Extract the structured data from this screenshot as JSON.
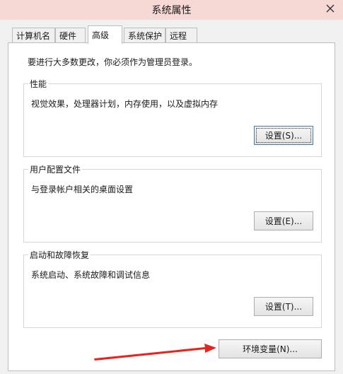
{
  "window": {
    "title": "系统属性"
  },
  "tabs": [
    {
      "label": "计算机名",
      "active": false
    },
    {
      "label": "硬件",
      "active": false
    },
    {
      "label": "高级",
      "active": true
    },
    {
      "label": "系统保护",
      "active": false
    },
    {
      "label": "远程",
      "active": false
    }
  ],
  "intro_text": "要进行大多数更改，你必须作为管理员登录。",
  "groups": [
    {
      "legend": "性能",
      "description": "视觉效果，处理器计划，内存使用，以及虚拟内存",
      "button": "设置(S)..."
    },
    {
      "legend": "用户配置文件",
      "description": "与登录帐户相关的桌面设置",
      "button": "设置(E)..."
    },
    {
      "legend": "启动和故障恢复",
      "description": "系统启动、系统故障和调试信息",
      "button": "设置(T)..."
    }
  ],
  "env_button": "环境变量(N)...",
  "icons": {
    "close": "close-icon",
    "annotation": "red-arrow-icon"
  },
  "colors": {
    "titlebar": "#f6d9d5",
    "arrow": "#e8231e",
    "background": "#f0f0f0"
  }
}
